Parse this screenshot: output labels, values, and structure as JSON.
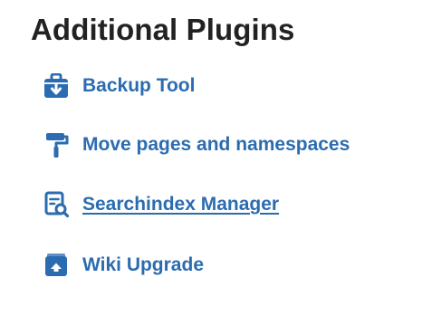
{
  "section": {
    "title": "Additional Plugins"
  },
  "plugins": [
    {
      "label": "Backup Tool",
      "icon": "backup-toolbox-icon",
      "underlined": false
    },
    {
      "label": "Move pages and namespaces",
      "icon": "paint-roller-icon",
      "underlined": false
    },
    {
      "label": "Searchindex Manager",
      "icon": "search-document-icon",
      "underlined": true
    },
    {
      "label": "Wiki Upgrade",
      "icon": "upgrade-arrow-icon",
      "underlined": false
    }
  ],
  "colors": {
    "heading": "#222222",
    "link": "#2b6cb0",
    "icon": "#2b6cb0"
  }
}
